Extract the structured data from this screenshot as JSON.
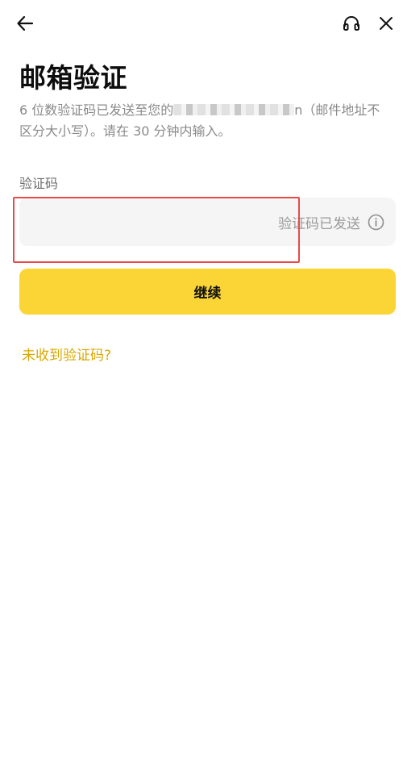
{
  "title": "邮箱验证",
  "description": {
    "before_email": "6 位数验证码已发送至您的",
    "email_suffix": "n",
    "after_email": "（邮件地址不区分大小写）。请在 30 分钟内输入。"
  },
  "field": {
    "label": "验证码",
    "value": "",
    "placeholder": "",
    "status_text": "验证码已发送"
  },
  "buttons": {
    "continue_label": "继续"
  },
  "links": {
    "no_code": "未收到验证码?"
  },
  "icons": {
    "back": "arrow-left-icon",
    "support": "headset-icon",
    "close": "close-icon",
    "info": "info-icon"
  },
  "colors": {
    "accent": "#fbd535",
    "link": "#d9a800",
    "input_bg": "#f5f5f5",
    "highlight": "#e84a4a"
  }
}
